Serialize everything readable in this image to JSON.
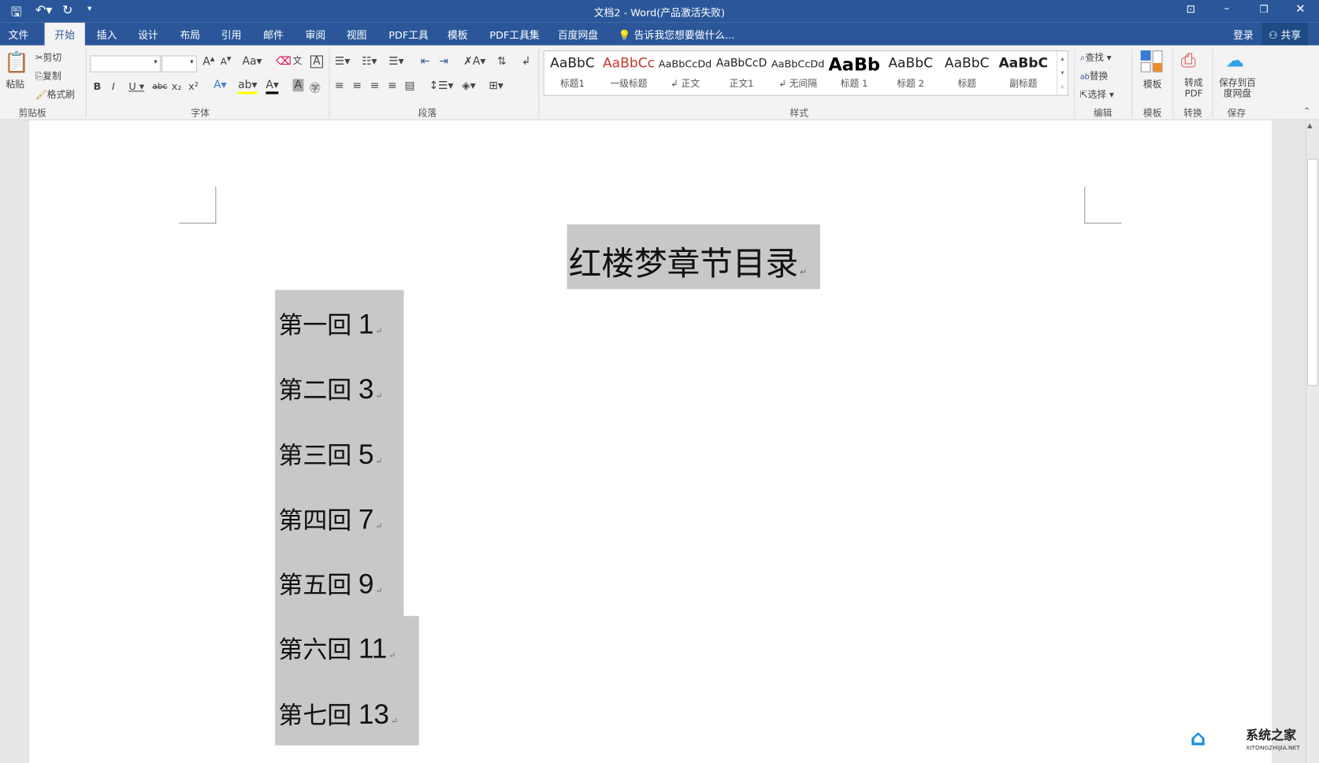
{
  "window": {
    "title": "文档2 - Word(产品激活失败)",
    "controls": [
      "ribbon-display",
      "minimize",
      "restore",
      "close"
    ]
  },
  "qat": {
    "save": "save-icon",
    "undo": "undo-icon",
    "redo": "redo-icon",
    "customize": "▾"
  },
  "tabs": [
    "文件",
    "开始",
    "插入",
    "设计",
    "布局",
    "引用",
    "邮件",
    "审阅",
    "视图",
    "PDF工具",
    "模板",
    "PDF工具集",
    "百度网盘"
  ],
  "active_tab": "开始",
  "tell_me": "告诉我您想要做什么...",
  "account": {
    "login": "登录",
    "share": "共享"
  },
  "clipboard": {
    "paste": "粘贴",
    "cut": "剪切",
    "copy": "复制",
    "format_painter": "格式刷",
    "label": "剪贴板"
  },
  "font": {
    "name": "",
    "size": "",
    "label": "字体"
  },
  "paragraph": {
    "label": "段落"
  },
  "styles": {
    "label": "样式",
    "items": [
      {
        "preview": "AaBbC",
        "name": "标题1",
        "color": "#222222"
      },
      {
        "preview": "AaBbCc",
        "name": "一级标题",
        "color": "#c0392b"
      },
      {
        "preview": "AaBbCcDd",
        "name": "↲ 正文",
        "color": "#222222"
      },
      {
        "preview": "AaBbCcD",
        "name": "正文1",
        "color": "#222222"
      },
      {
        "preview": "AaBbCcDd",
        "name": "↲ 无间隔",
        "color": "#222222"
      },
      {
        "preview": "AaBb",
        "name": "标题 1",
        "color": "#000000"
      },
      {
        "preview": "AaBbC",
        "name": "标题 2",
        "color": "#222222"
      },
      {
        "preview": "AaBbC",
        "name": "标题",
        "color": "#222222"
      },
      {
        "preview": "AaBbC",
        "name": "副标题",
        "color": "#222222"
      }
    ]
  },
  "editing": {
    "find": "查找",
    "replace": "替换",
    "select": "选择",
    "label": "编辑"
  },
  "template": {
    "button": "模板",
    "label": "模板"
  },
  "convert": {
    "button": "转成PDF",
    "label": "转换"
  },
  "save_group": {
    "button": "保存到百度网盘",
    "label": "保存"
  },
  "document": {
    "title": "红楼梦章节目录",
    "entries": [
      {
        "text": "第一回",
        "page": "1"
      },
      {
        "text": "第二回",
        "page": "3"
      },
      {
        "text": "第三回",
        "page": "5"
      },
      {
        "text": "第四回",
        "page": "7"
      },
      {
        "text": "第五回",
        "page": "9"
      },
      {
        "text": "第六回",
        "page": "11"
      },
      {
        "text": "第七回",
        "page": "13"
      }
    ]
  },
  "watermark": {
    "name": "系统之家",
    "url": "XITONGZHIJIA.NET"
  }
}
